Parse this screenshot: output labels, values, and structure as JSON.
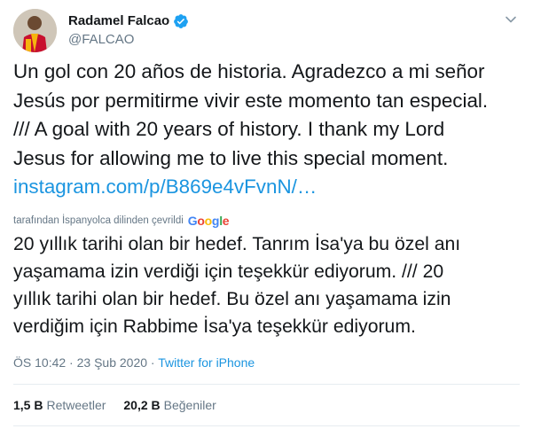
{
  "author": {
    "display_name": "Radamel Falcao",
    "handle": "@FALCAO",
    "verified": true
  },
  "tweet": {
    "lines": [
      "Un gol con 20 años de historia. Agradezco a mi señor",
      "Jesús por permitirme vivir este momento tan especial.",
      "/// A goal with 20 years of history. I thank my Lord",
      "Jesus for allowing me to live this special moment."
    ],
    "link": "instagram.com/p/B869e4vFvnN/…"
  },
  "translation": {
    "label": "tarafından İspanyolca dilinden çevrildi",
    "provider": "Google",
    "lines": [
      "20 yıllık tarihi olan bir hedef. Tanrım İsa'ya bu özel anı",
      "yaşamama izin verdiği için teşekkür ediyorum. /// 20",
      "yıllık tarihi olan bir hedef. Bu özel anı yaşamama izin",
      "verdiğim için Rabbime İsa'ya teşekkür ediyorum."
    ]
  },
  "meta": {
    "time": "ÖS 10:42",
    "separator1": "·",
    "date": "23 Şub 2020",
    "separator2": "·",
    "source": "Twitter for iPhone"
  },
  "stats": {
    "retweets_count": "1,5 B",
    "retweets_label": "Retweetler",
    "likes_count": "20,2 B",
    "likes_label": "Beğeniler"
  },
  "colors": {
    "link": "#1b95e0",
    "verified": "#1da1f2",
    "muted": "#657786",
    "border": "#e6ecf0"
  }
}
